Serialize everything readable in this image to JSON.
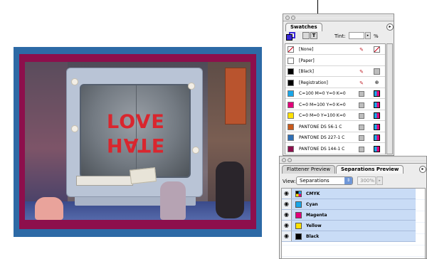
{
  "document": {
    "artwork_words": [
      "LOVE",
      "HATE"
    ],
    "colors": {
      "outer": "#2d6aa6",
      "inner": "#8d0f4c",
      "word": "#d9262e"
    }
  },
  "swatches_panel": {
    "tab_label": "Swatches",
    "tint_label": "Tint:",
    "tint_value": "",
    "tint_unit": "%",
    "format_buttons": [
      "",
      "T"
    ],
    "items": [
      {
        "name": "[None]",
        "color": "none",
        "icon1": "no-edit-icon",
        "icon2": "none-icon"
      },
      {
        "name": "[Paper]",
        "color": "#ffffff",
        "icon1": "",
        "icon2": ""
      },
      {
        "name": "[Black]",
        "color": "#000000",
        "icon1": "no-edit-icon",
        "icon2": "process-icon"
      },
      {
        "name": "[Registration]",
        "color": "#000000",
        "icon1": "no-edit-icon",
        "icon2": "registration-icon"
      },
      {
        "name": "C=100 M=0 Y=0 K=0",
        "color": "#19a6e8",
        "icon1": "process-icon",
        "icon2": "cmyk-icon"
      },
      {
        "name": "C=0 M=100 Y=0 K=0",
        "color": "#e2007a",
        "icon1": "process-icon",
        "icon2": "cmyk-icon"
      },
      {
        "name": "C=0 M=0 Y=100 K=0",
        "color": "#ffe100",
        "icon1": "process-icon",
        "icon2": "cmyk-icon"
      },
      {
        "name": "PANTONE DS 56-1 C",
        "color": "#c95a1c",
        "icon1": "process-icon",
        "icon2": "cmyk-icon"
      },
      {
        "name": "PANTONE DS 227-1 C",
        "color": "#2f6fb5",
        "icon1": "process-icon",
        "icon2": "cmyk-icon"
      },
      {
        "name": "PANTONE DS 144-1 C",
        "color": "#8d0f4c",
        "icon1": "process-icon",
        "icon2": "cmyk-icon"
      }
    ]
  },
  "separations_panel": {
    "tabs": [
      "Flattener Preview",
      "Separations Preview"
    ],
    "view_label": "View:",
    "view_value": "Separations",
    "zoom_value": "300%",
    "rows": [
      {
        "name": "CMYK",
        "color": "cmyk"
      },
      {
        "name": "Cyan",
        "color": "#19a6e8"
      },
      {
        "name": "Magenta",
        "color": "#e2007a"
      },
      {
        "name": "Yellow",
        "color": "#ffe100"
      },
      {
        "name": "Black",
        "color": "#000000"
      }
    ]
  }
}
